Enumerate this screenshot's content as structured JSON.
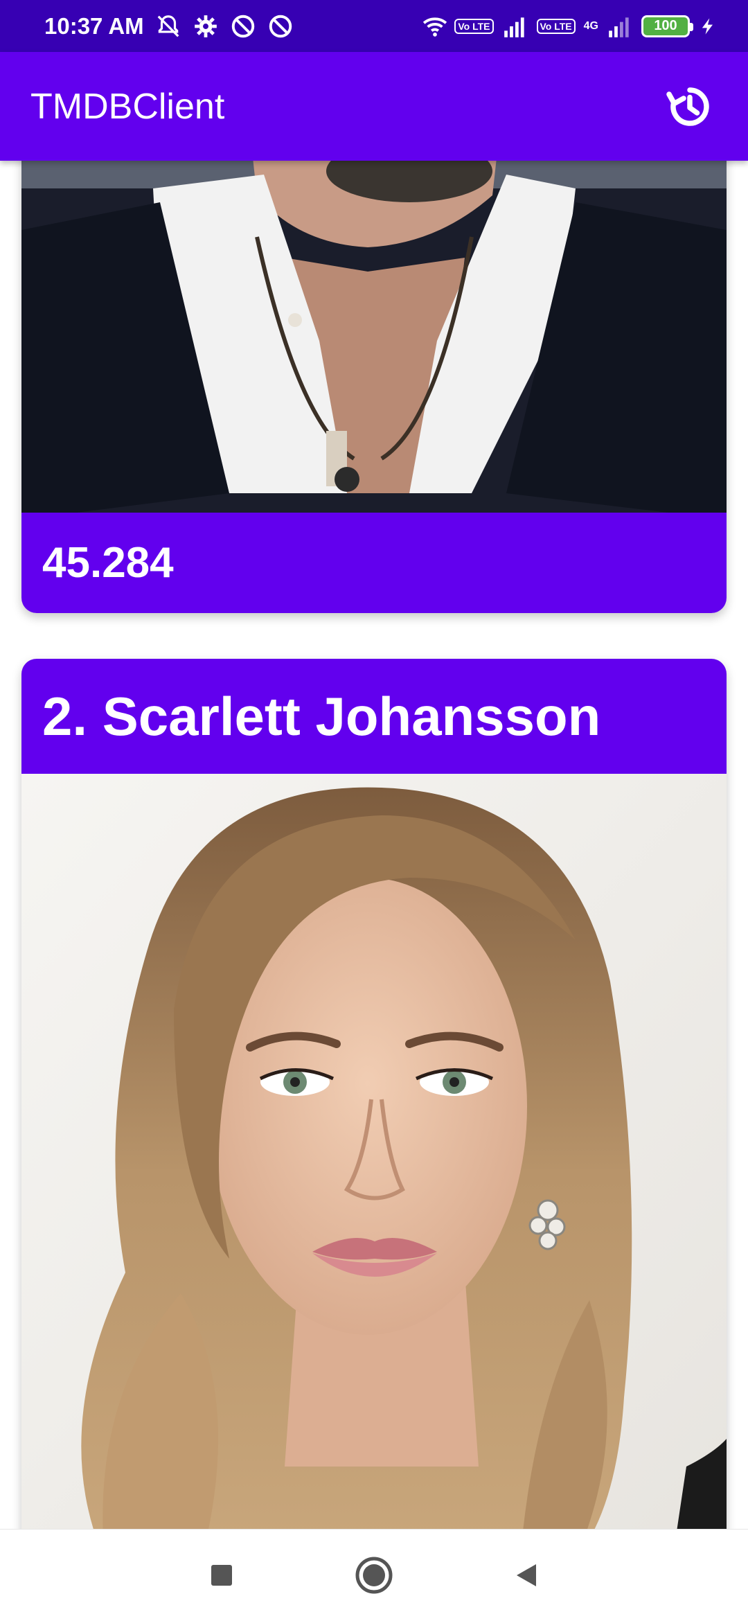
{
  "status_bar": {
    "time": "10:37 AM",
    "network_chip_1": "Vo LTE",
    "network_chip_2": "Vo LTE",
    "network_label": "4G",
    "battery": "100"
  },
  "app_bar": {
    "title": "TMDBClient",
    "refresh_icon": "history-refresh-icon"
  },
  "cards": [
    {
      "title": "",
      "popularity": "45.284",
      "photo_icon": "person-photo"
    },
    {
      "title": "2. Scarlett Johansson",
      "popularity": "",
      "photo_icon": "person-photo"
    }
  ],
  "nav_bar": {
    "recents": "square-icon",
    "home": "circle-icon",
    "back": "triangle-back-icon"
  },
  "colors": {
    "status_bar": "#3700b3",
    "primary": "#6200ee"
  }
}
